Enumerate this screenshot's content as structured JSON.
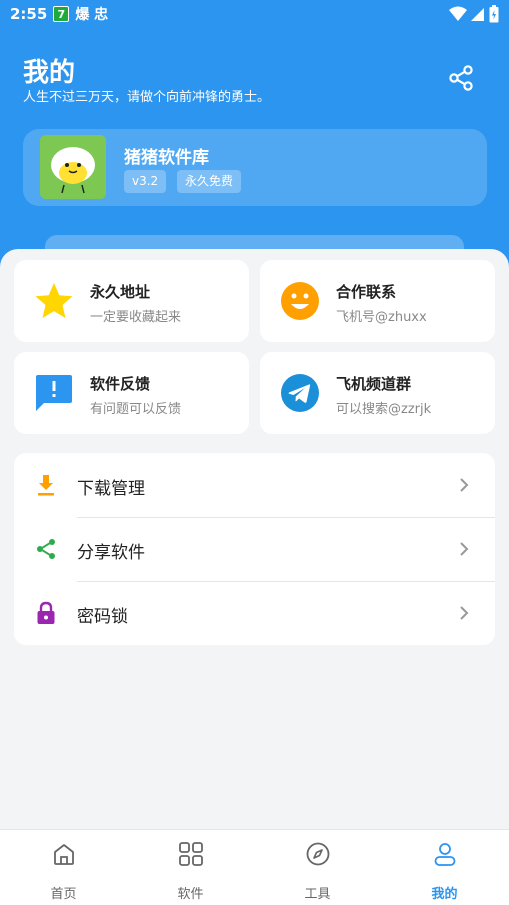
{
  "status_bar": {
    "time": "2:55",
    "badge": "7",
    "app_label": "爆 忠"
  },
  "header": {
    "title": "我的",
    "subtitle": "人生不过三万天，请做个向前冲锋的勇士。"
  },
  "profile": {
    "app_name": "猪猪软件库",
    "version": "v3.2",
    "tag": "永久免费"
  },
  "quick_cards": [
    {
      "title": "永久地址",
      "subtitle": "一定要收藏起来",
      "icon": "star-icon",
      "color": "#ffd600"
    },
    {
      "title": "合作联系",
      "subtitle": "飞机号@zhuxx",
      "icon": "smile-icon",
      "color": "#ff9f00"
    },
    {
      "title": "软件反馈",
      "subtitle": "有问题可以反馈",
      "icon": "feedback-icon",
      "color": "#2b95ef"
    },
    {
      "title": "飞机频道群",
      "subtitle": "可以搜索@zzrjk",
      "icon": "telegram-icon",
      "color": "#1b8fd8"
    }
  ],
  "menu": [
    {
      "label": "下载管理",
      "icon": "download-icon",
      "color": "#ff9f00"
    },
    {
      "label": "分享软件",
      "icon": "share-icon",
      "color": "#2eaa4a"
    },
    {
      "label": "密码锁",
      "icon": "lock-icon",
      "color": "#9b27b0"
    }
  ],
  "tabs": [
    {
      "label": "首页",
      "icon": "home-icon"
    },
    {
      "label": "软件",
      "icon": "grid-icon"
    },
    {
      "label": "工具",
      "icon": "compass-icon"
    },
    {
      "label": "我的",
      "icon": "user-icon",
      "active": true
    }
  ],
  "colors": {
    "primary": "#2b95ef",
    "background": "#f3f4f6"
  }
}
